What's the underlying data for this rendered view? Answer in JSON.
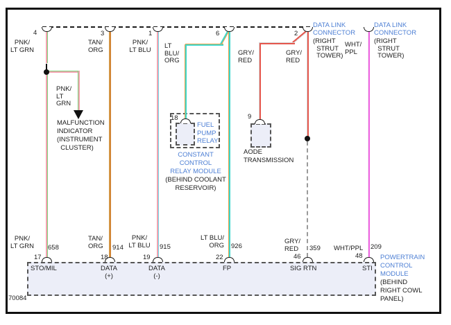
{
  "figure_number": "70084",
  "colors": {
    "component_label_blue": "#4d7fd4",
    "pnk": "#f3a3b0",
    "lt_grn": "#7bd37b",
    "tan": "#d49544",
    "org": "#cf7a28",
    "lt_blu": "#3ed8cc",
    "gry": "#d9d9d9",
    "red": "#e5574d",
    "wht": "#f3e3f3",
    "ppl": "#ee63e0"
  },
  "data_link_connector_1": {
    "name": "DATA LINK\nCONNECTOR",
    "location": "(RIGHT\n  STRUT\n  TOWER)"
  },
  "data_link_connector_2": {
    "name": "DATA LINK\nCONNECTOR",
    "location": "(RIGHT\n  STRUT\n  TOWER)"
  },
  "top_pins": [
    {
      "number": "4",
      "wire": "PNK/\nLT GRN"
    },
    {
      "number": "3",
      "wire": "TAN/\nORG"
    },
    {
      "number": "1",
      "wire": "PNK/\nLT BLU"
    },
    {
      "number": "6",
      "wire": "LT\nBLU/\nORG"
    },
    {
      "number": "2",
      "wire": "GRY/\nRED"
    }
  ],
  "mid_labels": {
    "gry_red_branch": "GRY/\nRED",
    "wht_ppl": "WHT/\nPPL",
    "pnk_lt_grn_branch": "PNK/\nLT\nGRN"
  },
  "malfunction_indicator": "MALFUNCTION\nINDICATOR\n(INSTRUMENT\n  CLUSTER)",
  "fuel_pump_relay": {
    "pin": "18",
    "name": "FUEL\nPUMP\nRELAY"
  },
  "ccrm": {
    "name": "CONSTANT\nCONTROL\nRELAY MODULE",
    "location": "(BEHIND COOLANT\nRESERVOIR)"
  },
  "aode": {
    "pin": "9",
    "name": "AODE\nTRANSMISSION"
  },
  "pcm": {
    "name": "POWERTRAIN\nCONTROL\nMODULE",
    "location": "(BEHIND\nRIGHT COWL\nPANEL)",
    "pins": [
      {
        "wire": "PNK/\nLT GRN",
        "circuit": "658",
        "number": "17",
        "terminal": "STO/MIL"
      },
      {
        "wire": "TAN/\nORG",
        "circuit": "914",
        "number": "18",
        "terminal": "DATA\n(+)"
      },
      {
        "wire": "PNK/\nLT BLU",
        "circuit": "915",
        "number": "19",
        "terminal": "DATA\n(-)"
      },
      {
        "wire": "LT BLU/\nORG",
        "circuit": "926",
        "number": "22",
        "terminal": "FP"
      },
      {
        "wire": "GRY/\nRED",
        "circuit": "359",
        "number": "46",
        "terminal": "SIG RTN"
      },
      {
        "wire": "WHT/PPL",
        "circuit": "209",
        "number": "48",
        "terminal": "STI"
      }
    ]
  }
}
